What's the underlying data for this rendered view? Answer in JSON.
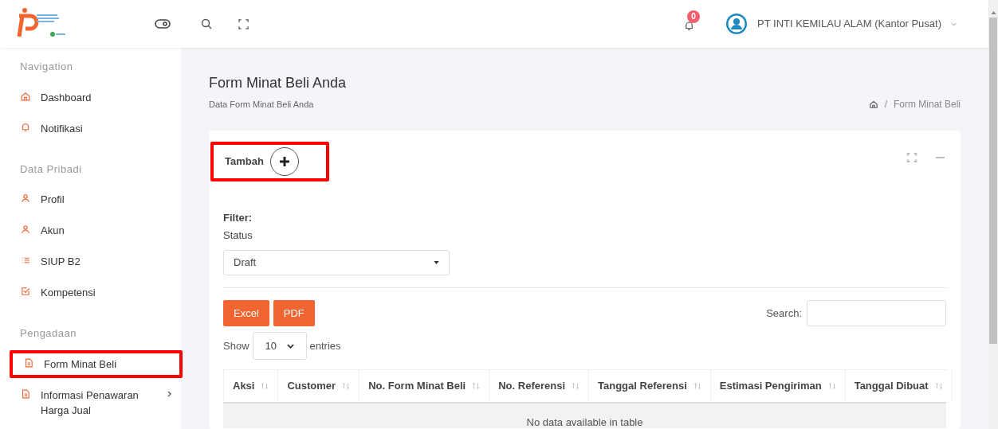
{
  "header": {
    "notifications": {
      "count": "0"
    },
    "user": {
      "name": "PT INTI KEMILAU ALAM (Kantor Pusat)"
    }
  },
  "sidebar": {
    "sections": [
      {
        "title": "Navigation",
        "items": [
          {
            "label": "Dashboard",
            "annotated": false,
            "has_children": false
          },
          {
            "label": "Notifikasi",
            "annotated": false,
            "has_children": false
          }
        ]
      },
      {
        "title": "Data Pribadi",
        "items": [
          {
            "label": "Profil",
            "annotated": false,
            "has_children": false
          },
          {
            "label": "Akun",
            "annotated": false,
            "has_children": false
          },
          {
            "label": "SIUP B2",
            "annotated": false,
            "has_children": false
          },
          {
            "label": "Kompetensi",
            "annotated": false,
            "has_children": false
          }
        ]
      },
      {
        "title": "Pengadaan",
        "items": [
          {
            "label": "Form Minat Beli",
            "annotated": true,
            "has_children": false
          },
          {
            "label": "Informasi Penawaran Harga Jual",
            "annotated": false,
            "has_children": true
          }
        ]
      }
    ]
  },
  "page": {
    "title": "Form Minat Beli Anda",
    "subtitle": "Data Form Minat Beli Anda",
    "breadcrumb": {
      "separator": "/",
      "items": [
        "Form Minat Beli"
      ]
    }
  },
  "card": {
    "add": {
      "label": "Tambah",
      "annotated": true
    },
    "filter": {
      "heading": "Filter:",
      "label": "Status",
      "value": "Draft"
    },
    "export_buttons": [
      "Excel",
      "PDF"
    ],
    "length": {
      "prefix": "Show",
      "value": "10",
      "suffix": "entries"
    },
    "search": {
      "label": "Search:"
    },
    "table": {
      "columns": [
        "Aksi",
        "Customer",
        "No. Form Minat Beli",
        "No. Referensi",
        "Tanggal Referensi",
        "Estimasi Pengiriman",
        "Tanggal Dibuat"
      ],
      "empty": "No data available in table"
    }
  }
}
